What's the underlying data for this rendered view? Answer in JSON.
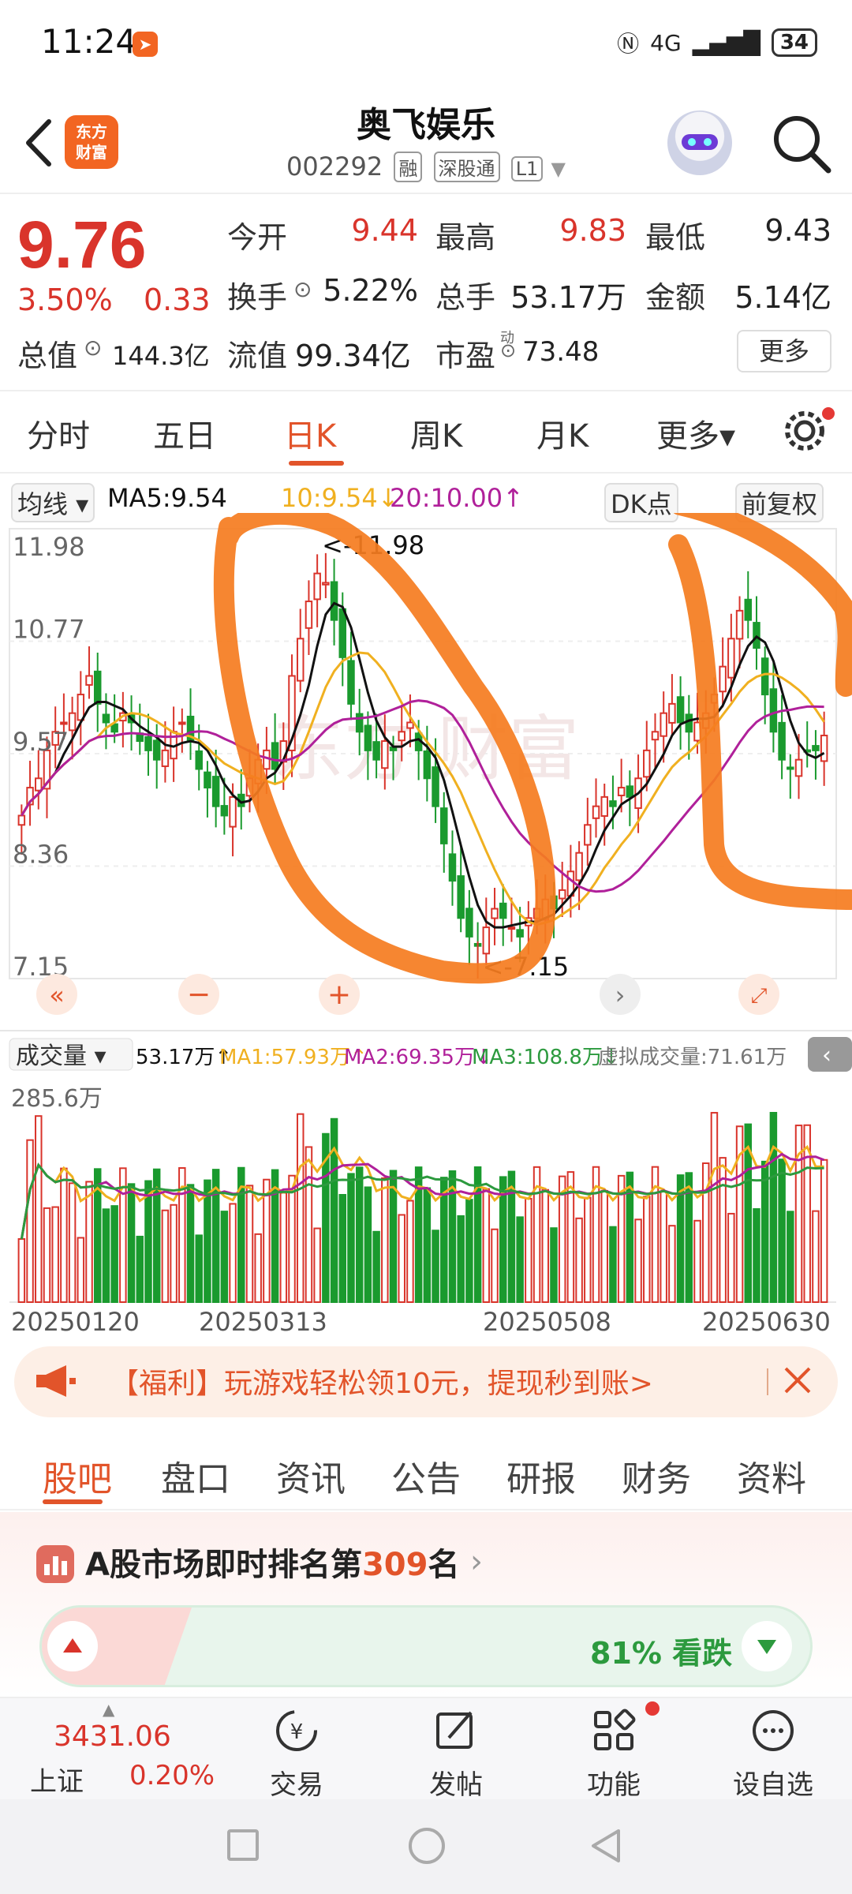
{
  "status_bar": {
    "time": "11:24",
    "network": "4G",
    "battery": "34"
  },
  "header": {
    "brand_logo": "东方\n财富",
    "stock_name": "奥飞娱乐",
    "stock_code": "002292",
    "tags": [
      "融",
      "深股通",
      "L1"
    ]
  },
  "quote": {
    "price": "9.76",
    "change_pct": "3.50%",
    "change": "0.33",
    "open_label": "今开",
    "open": "9.44",
    "high_label": "最高",
    "high": "9.83",
    "low_label": "最低",
    "low": "9.43",
    "turnover_label": "换手",
    "turnover": "5.22%",
    "volume_label": "总手",
    "volume": "53.17万",
    "amount_label": "金额",
    "amount": "5.14亿",
    "mktcap_label": "总值",
    "mktcap": "144.3亿",
    "float_label": "流值",
    "float_cap": "99.34亿",
    "pe_label": "市盈",
    "pe_sup": "动",
    "pe": "73.48",
    "more_label": "更多"
  },
  "period_tabs": [
    "分时",
    "五日",
    "日K",
    "周K",
    "月K",
    "更多▾"
  ],
  "active_period": 2,
  "ma_legend": {
    "selector": "均线 ▾",
    "ma5": "MA5:9.54",
    "ma10": "10:9.54↓",
    "ma20": "20:10.00↑",
    "dk_label": "DK点",
    "adjust_label": "前复权",
    "colors": {
      "ma5": "#111111",
      "ma10": "#f0b020",
      "ma20": "#b0209a"
    }
  },
  "chart_data": {
    "type": "candlestick",
    "price_axis": [
      "11.98",
      "10.77",
      "9.57",
      "8.36",
      "7.15"
    ],
    "ylim": [
      7.15,
      11.98
    ],
    "max_marker": "<-11.98",
    "min_marker": "<-7.15",
    "date_labels": [
      "20250120",
      "20250313",
      "20250508",
      "20250630"
    ],
    "volume_legend": {
      "selector": "成交量 ▾",
      "volume": "53.17万↑",
      "ma1": "MA1:57.93万↑",
      "ma2": "MA2:69.35万↓",
      "ma3": "MA3:108.8万↓",
      "virtual": "虚拟成交量:71.61万"
    },
    "volume_max_label": "285.6万",
    "close_series": [
      8.9,
      9.2,
      9.3,
      9.6,
      9.8,
      9.9,
      10.0,
      10.2,
      10.4,
      10.1,
      9.9,
      9.8,
      10.0,
      9.9,
      9.7,
      9.6,
      9.5,
      9.6,
      9.8,
      9.9,
      9.7,
      9.4,
      9.2,
      9.0,
      8.9,
      9.1,
      9.0,
      9.3,
      9.5,
      9.6,
      9.4,
      9.7,
      10.4,
      10.8,
      11.2,
      11.5,
      11.4,
      11.0,
      10.6,
      10.1,
      9.8,
      9.6,
      9.5,
      9.7,
      9.6,
      9.8,
      9.9,
      9.6,
      9.3,
      9.0,
      8.6,
      8.2,
      7.8,
      7.6,
      7.5,
      7.7,
      7.9,
      7.8,
      7.7,
      7.6,
      7.8,
      7.9,
      8.0,
      7.9,
      8.1,
      8.3,
      8.5,
      8.8,
      9.0,
      9.1,
      9.0,
      9.2,
      9.1,
      9.3,
      9.6,
      9.8,
      10.0,
      10.1,
      9.9,
      9.8,
      9.9,
      10.0,
      10.2,
      10.5,
      10.8,
      11.1,
      11.0,
      10.7,
      10.2,
      9.8,
      9.5,
      9.4,
      9.5,
      9.6,
      9.6,
      9.76
    ]
  },
  "notice": {
    "text": "【福利】玩游戏轻松领10元，提现秒到账>"
  },
  "content_tabs": [
    "股吧",
    "盘口",
    "资讯",
    "公告",
    "研报",
    "财务",
    "资料"
  ],
  "active_content": 0,
  "ranking": {
    "prefix": "A股市场即时排名第",
    "rank": "309",
    "suffix": "名"
  },
  "sentiment": {
    "text": "81% 看跌",
    "down_pct": 81
  },
  "toolbar": {
    "index_value": "3431.06",
    "index_name": "上证",
    "index_pct": "0.20%",
    "items": [
      "交易",
      "发帖",
      "功能",
      "设自选"
    ]
  }
}
